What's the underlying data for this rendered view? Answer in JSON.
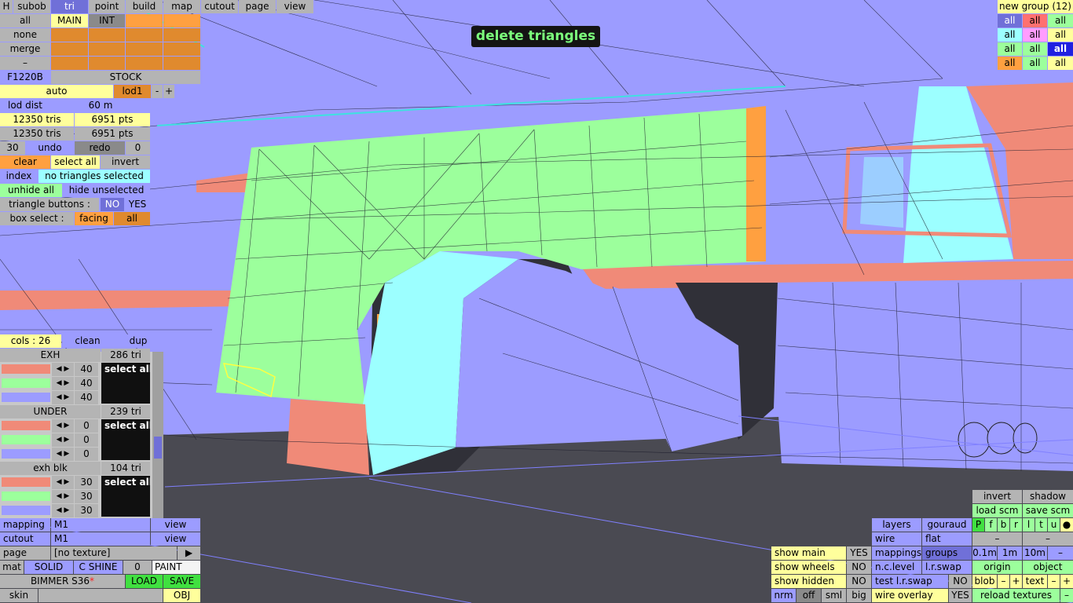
{
  "tooltip": "delete triangles",
  "top_tabs": [
    "H",
    "subob",
    "tri",
    "point",
    "build",
    "map",
    "cutout",
    "page",
    "view"
  ],
  "left": {
    "all": "all",
    "none": "none",
    "merge": "merge",
    "dash": "–",
    "main": "MAIN",
    "int": "INT",
    "model": "F1220B",
    "stock": "STOCK",
    "auto": "auto",
    "lod": "lod1",
    "minus": "-",
    "plus": "+",
    "lod_dist_label": "lod dist",
    "lod_dist_val": "60 m",
    "tris1": "12350 tris",
    "pts1": "6951 pts",
    "tris2": "12350 tris",
    "pts2": "6951 pts",
    "undo_count": "30",
    "undo": "undo",
    "redo": "redo",
    "redo_count": "0",
    "clear": "clear",
    "select_all": "select all",
    "invert": "invert",
    "index": "index",
    "no_sel": "no triangles selected",
    "unhide_all": "unhide all",
    "hide_unselected": "hide unselected",
    "tri_buttons": "triangle buttons :",
    "no": "NO",
    "yes": "YES",
    "box_select": "box select :",
    "facing": "facing",
    "box_all": "all"
  },
  "cols": {
    "label": "cols : 26",
    "clean": "clean",
    "dup": "dup"
  },
  "groups": [
    {
      "name": "EXH",
      "tri": "286 tri",
      "vals": [
        "40",
        "40",
        "40"
      ],
      "sel": "select all"
    },
    {
      "name": "UNDER",
      "tri": "239 tri",
      "vals": [
        "0",
        "0",
        "0"
      ],
      "sel": "select all"
    },
    {
      "name": "exh blk",
      "tri": "104 tri",
      "vals": [
        "30",
        "30",
        "30"
      ],
      "sel": "select all"
    }
  ],
  "bottom_left": {
    "mapping": "mapping",
    "m1a": "M1",
    "view1": "view",
    "cutout": "cutout",
    "m1b": "M1",
    "view2": "view",
    "page": "page",
    "no_tex": "[no texture]",
    "arrow": "▶",
    "mat": "mat",
    "solid": "SOLID",
    "cshine": "C SHINE",
    "zero": "0",
    "paint": "PAINT",
    "car": "BIMMER S36",
    "star": "*",
    "load": "LOAD",
    "save": "SAVE",
    "skin": "skin",
    "obj": "OBJ"
  },
  "new_group": {
    "title": "new group (12)",
    "cells": [
      "all",
      "all",
      "all",
      "all",
      "all",
      "all",
      "all",
      "all",
      "all",
      "all",
      "all",
      "all"
    ]
  },
  "bottom_right": {
    "show_main": "show main",
    "yes1": "YES",
    "show_wheels": "show wheels",
    "no1": "NO",
    "show_hidden": "show hidden",
    "no2": "NO",
    "nrm": "nrm",
    "off": "off",
    "sml": "sml",
    "big": "big",
    "layers": "layers",
    "gouraud": "gouraud",
    "wire": "wire",
    "flat": "flat",
    "mappings": "mappings",
    "groups": "groups",
    "nclevel": "n.c.level",
    "lrswap": "l.r.swap",
    "test_lr": "test l.r.swap",
    "no3": "NO",
    "wire_overlay": "wire overlay",
    "yes2": "YES",
    "invert": "invert",
    "shadow": "shadow",
    "load_scm": "load scm",
    "save_scm": "save scm",
    "flags": [
      "P",
      "f",
      "b",
      "r",
      "l",
      "t",
      "u",
      "●"
    ],
    "d1": "–",
    "d2": "–",
    "s01": "0.1m",
    "s1": "1m",
    "s10": "10m",
    "s_dash": "–",
    "origin": "origin",
    "object": "object",
    "blob": "blob",
    "b_minus": "–",
    "b_plus": "+",
    "text": "text",
    "t_minus": "–",
    "t_plus": "+",
    "reload": "reload textures",
    "r_dash": "–"
  },
  "colors": {
    "body": "#9c9cff",
    "fender": "#9cff9c",
    "salmon": "#f08a78",
    "cyan": "#9cffff",
    "orange": "#ffa040",
    "ground": "#4a4a52"
  }
}
